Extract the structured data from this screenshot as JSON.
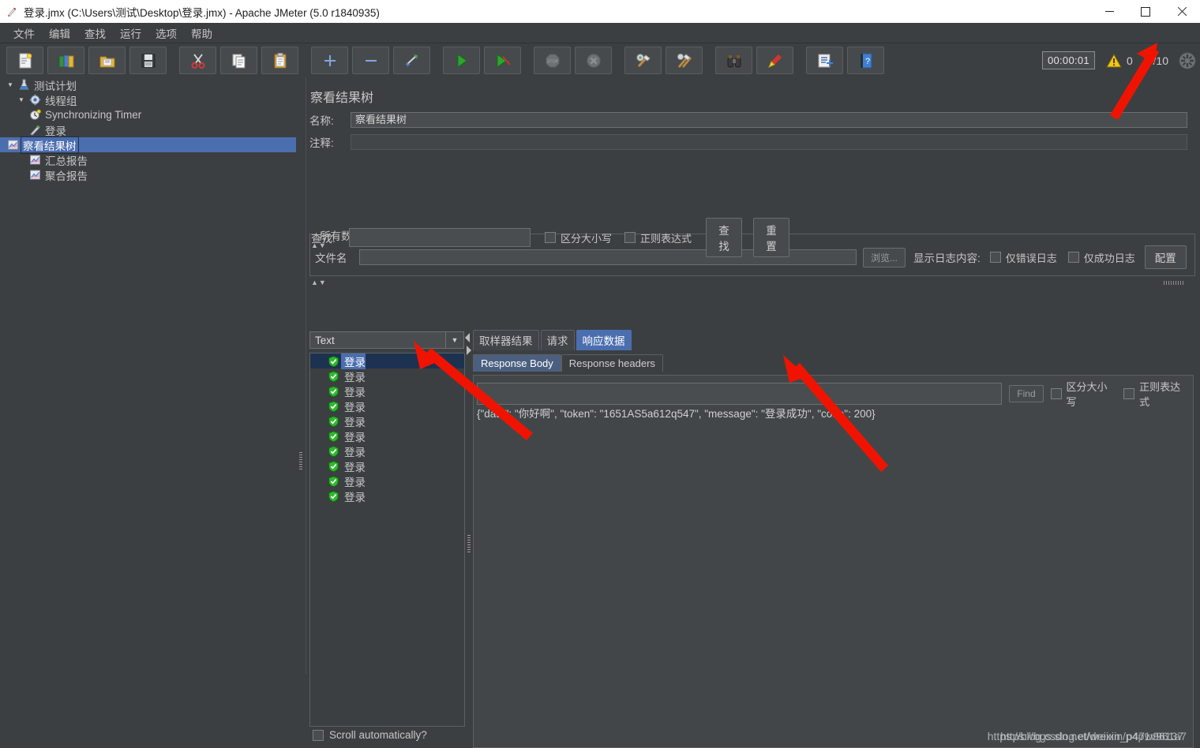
{
  "window": {
    "title": "登录.jmx (C:\\Users\\测试\\Desktop\\登录.jmx) - Apache JMeter (5.0 r1840935)",
    "app_icon": "jmeter-feather-icon",
    "minimize_label": "—",
    "maximize_label": "□",
    "close_label": "✕"
  },
  "menu": {
    "items": [
      {
        "label": "文件",
        "name": "menu-file"
      },
      {
        "label": "编辑",
        "name": "menu-edit"
      },
      {
        "label": "查找",
        "name": "menu-search"
      },
      {
        "label": "运行",
        "name": "menu-run"
      },
      {
        "label": "选项",
        "name": "menu-options"
      },
      {
        "label": "帮助",
        "name": "menu-help"
      }
    ]
  },
  "toolbar": {
    "buttons": [
      {
        "icon": "new-document-icon",
        "name": "toolbar-new"
      },
      {
        "icon": "templates-icon",
        "name": "toolbar-templates"
      },
      {
        "icon": "open-folder-icon",
        "name": "toolbar-open"
      },
      {
        "icon": "save-floppy-icon",
        "name": "toolbar-save"
      },
      {
        "icon": "cut-scissors-icon",
        "name": "toolbar-cut"
      },
      {
        "icon": "copy-icon",
        "name": "toolbar-copy"
      },
      {
        "icon": "paste-clipboard-icon",
        "name": "toolbar-paste"
      },
      {
        "icon": "plus-icon",
        "name": "toolbar-expand-all"
      },
      {
        "icon": "minus-icon",
        "name": "toolbar-collapse-all"
      },
      {
        "icon": "toggle-icon",
        "name": "toolbar-toggle"
      },
      {
        "icon": "play-green-icon",
        "name": "toolbar-start"
      },
      {
        "icon": "play-no-timers-icon",
        "name": "toolbar-start-no-pauses"
      },
      {
        "icon": "stop-icon",
        "name": "toolbar-stop"
      },
      {
        "icon": "shutdown-icon",
        "name": "toolbar-shutdown"
      },
      {
        "icon": "clear-icon",
        "name": "toolbar-clear"
      },
      {
        "icon": "clear-all-icon",
        "name": "toolbar-clear-all"
      },
      {
        "icon": "binoculars-icon",
        "name": "toolbar-search"
      },
      {
        "icon": "reset-search-icon",
        "name": "toolbar-reset-search"
      },
      {
        "icon": "function-helper-icon",
        "name": "toolbar-function-helper"
      },
      {
        "icon": "help-icon",
        "name": "toolbar-help"
      }
    ],
    "timer": "00:00:01",
    "warning_icon": "warning-triangle-icon",
    "warning_count": "0",
    "thread_count": "0/10",
    "thread_icon": "active-threads-icon"
  },
  "tree": {
    "nodes": [
      {
        "label": "测试计划",
        "icon": "test-plan-icon",
        "indent": 1,
        "toggle": "▼",
        "selected": false,
        "name": "tree-node-test-plan"
      },
      {
        "label": "线程组",
        "icon": "thread-group-gear-icon",
        "indent": 2,
        "toggle": "▼",
        "selected": false,
        "name": "tree-node-thread-group"
      },
      {
        "label": "Synchronizing Timer",
        "icon": "timer-clock-icon",
        "indent": 3,
        "toggle": "",
        "selected": false,
        "name": "tree-node-sync-timer"
      },
      {
        "label": "登录",
        "icon": "http-sampler-icon",
        "indent": 3,
        "toggle": "",
        "selected": false,
        "name": "tree-node-login-sampler"
      },
      {
        "label": "察看结果树",
        "icon": "listener-chart-icon",
        "indent": 3,
        "toggle": "",
        "selected": true,
        "name": "tree-node-view-results-tree"
      },
      {
        "label": "汇总报告",
        "icon": "listener-chart-icon",
        "indent": 3,
        "toggle": "",
        "selected": false,
        "name": "tree-node-summary-report"
      },
      {
        "label": "聚合报告",
        "icon": "listener-chart-icon",
        "indent": 3,
        "toggle": "",
        "selected": false,
        "name": "tree-node-aggregate-report"
      }
    ]
  },
  "panel": {
    "title": "察看结果树",
    "name_label": "名称:",
    "name_value": "察看结果树",
    "comment_label": "注释:",
    "comment_value": "",
    "group_title": "所有数据写入一个文件",
    "filename_label": "文件名",
    "filename_value": "",
    "browse_label": "浏览...",
    "log_display_label": "显示日志内容:",
    "errors_only_label": "仅错误日志",
    "success_only_label": "仅成功日志",
    "configure_label": "配置",
    "search_label": "查找:",
    "search_value": "",
    "case_sensitive_label": "区分大小写",
    "regexp_label": "正则表达式",
    "search_button_label": "查找",
    "reset_button_label": "重置"
  },
  "results": {
    "renderer_selected": "Text",
    "renderer_arrow": "▼",
    "scroll_auto_label": "Scroll automatically?",
    "entries": [
      {
        "label": "登录",
        "status": "success",
        "selected": true
      },
      {
        "label": "登录",
        "status": "success",
        "selected": false
      },
      {
        "label": "登录",
        "status": "success",
        "selected": false
      },
      {
        "label": "登录",
        "status": "success",
        "selected": false
      },
      {
        "label": "登录",
        "status": "success",
        "selected": false
      },
      {
        "label": "登录",
        "status": "success",
        "selected": false
      },
      {
        "label": "登录",
        "status": "success",
        "selected": false
      },
      {
        "label": "登录",
        "status": "success",
        "selected": false
      },
      {
        "label": "登录",
        "status": "success",
        "selected": false
      },
      {
        "label": "登录",
        "status": "success",
        "selected": false
      }
    ]
  },
  "detail": {
    "tabs": [
      {
        "label": "取样器结果",
        "active": false,
        "name": "tab-sampler-result"
      },
      {
        "label": "请求",
        "active": false,
        "name": "tab-request"
      },
      {
        "label": "响应数据",
        "active": true,
        "name": "tab-response-data"
      }
    ],
    "subtabs": [
      {
        "label": "Response Body",
        "active": true,
        "name": "subtab-response-body"
      },
      {
        "label": "Response headers",
        "active": false,
        "name": "subtab-response-headers"
      }
    ],
    "find_value": "",
    "find_button_label": "Find",
    "case_sensitive_label": "区分大小写",
    "regexp_label": "正则表达式",
    "response_body": "{\"data\": \"你好啊\", \"token\": \"1651AS5a612q547\", \"message\": \"登录成功\", \"code\": 200}"
  },
  "watermark": {
    "line_a": "https://blog.csdn.net/weixin_p47w96137",
    "line_b": "https://bgs.slog.et/dreixin/p4p1v961a7"
  },
  "colors": {
    "background": "#3c3f41",
    "selection": "#4b6eaf",
    "annotation_arrow": "#f01400",
    "success": "#2eb82e"
  }
}
